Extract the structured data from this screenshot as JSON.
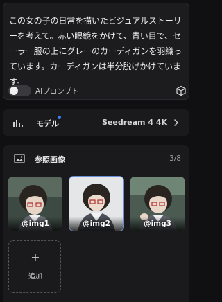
{
  "prompt": {
    "text": "この女の子の日常を描いたビジュアルストーリーを考えて。赤い眼鏡をかけて、青い目で、セーラー服の上にグレーのカーディガンを羽織っています。カーディガンは半分脱げかけています。",
    "ai_prompt_toggle_label": "AIプロンプト",
    "ai_prompt_enabled": false,
    "cube_icon": "cube-icon"
  },
  "model": {
    "icon": "bar-chart-icon",
    "label": "モデル",
    "value": "Seedream 4 4K",
    "chevron": "chevron-right-icon",
    "indicator_color": "#3b82f6"
  },
  "references": {
    "icon": "image-icon",
    "title": "参照画像",
    "count": "3/8",
    "images": [
      {
        "label": "@img1",
        "selected": false
      },
      {
        "label": "@img2",
        "selected": true
      },
      {
        "label": "@img3",
        "selected": false
      }
    ],
    "add_button": {
      "plus": "+",
      "label": "追加"
    }
  },
  "colors": {
    "background": "#101012",
    "panel": "#1a1a1d",
    "accent": "#3b82f6",
    "selected_outline": "#6b8fd6"
  }
}
